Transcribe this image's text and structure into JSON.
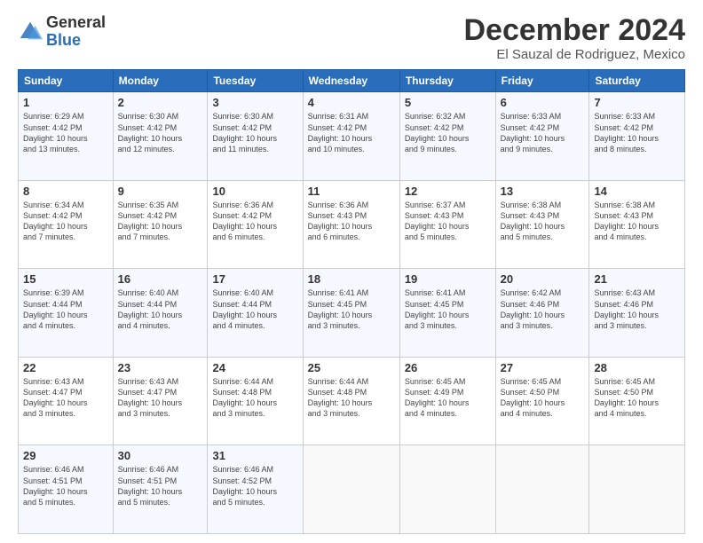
{
  "logo": {
    "general": "General",
    "blue": "Blue"
  },
  "title": "December 2024",
  "location": "El Sauzal de Rodriguez, Mexico",
  "headers": [
    "Sunday",
    "Monday",
    "Tuesday",
    "Wednesday",
    "Thursday",
    "Friday",
    "Saturday"
  ],
  "weeks": [
    [
      {
        "day": "1",
        "info": "Sunrise: 6:29 AM\nSunset: 4:42 PM\nDaylight: 10 hours\nand 13 minutes."
      },
      {
        "day": "2",
        "info": "Sunrise: 6:30 AM\nSunset: 4:42 PM\nDaylight: 10 hours\nand 12 minutes."
      },
      {
        "day": "3",
        "info": "Sunrise: 6:30 AM\nSunset: 4:42 PM\nDaylight: 10 hours\nand 11 minutes."
      },
      {
        "day": "4",
        "info": "Sunrise: 6:31 AM\nSunset: 4:42 PM\nDaylight: 10 hours\nand 10 minutes."
      },
      {
        "day": "5",
        "info": "Sunrise: 6:32 AM\nSunset: 4:42 PM\nDaylight: 10 hours\nand 9 minutes."
      },
      {
        "day": "6",
        "info": "Sunrise: 6:33 AM\nSunset: 4:42 PM\nDaylight: 10 hours\nand 9 minutes."
      },
      {
        "day": "7",
        "info": "Sunrise: 6:33 AM\nSunset: 4:42 PM\nDaylight: 10 hours\nand 8 minutes."
      }
    ],
    [
      {
        "day": "8",
        "info": "Sunrise: 6:34 AM\nSunset: 4:42 PM\nDaylight: 10 hours\nand 7 minutes."
      },
      {
        "day": "9",
        "info": "Sunrise: 6:35 AM\nSunset: 4:42 PM\nDaylight: 10 hours\nand 7 minutes."
      },
      {
        "day": "10",
        "info": "Sunrise: 6:36 AM\nSunset: 4:42 PM\nDaylight: 10 hours\nand 6 minutes."
      },
      {
        "day": "11",
        "info": "Sunrise: 6:36 AM\nSunset: 4:43 PM\nDaylight: 10 hours\nand 6 minutes."
      },
      {
        "day": "12",
        "info": "Sunrise: 6:37 AM\nSunset: 4:43 PM\nDaylight: 10 hours\nand 5 minutes."
      },
      {
        "day": "13",
        "info": "Sunrise: 6:38 AM\nSunset: 4:43 PM\nDaylight: 10 hours\nand 5 minutes."
      },
      {
        "day": "14",
        "info": "Sunrise: 6:38 AM\nSunset: 4:43 PM\nDaylight: 10 hours\nand 4 minutes."
      }
    ],
    [
      {
        "day": "15",
        "info": "Sunrise: 6:39 AM\nSunset: 4:44 PM\nDaylight: 10 hours\nand 4 minutes."
      },
      {
        "day": "16",
        "info": "Sunrise: 6:40 AM\nSunset: 4:44 PM\nDaylight: 10 hours\nand 4 minutes."
      },
      {
        "day": "17",
        "info": "Sunrise: 6:40 AM\nSunset: 4:44 PM\nDaylight: 10 hours\nand 4 minutes."
      },
      {
        "day": "18",
        "info": "Sunrise: 6:41 AM\nSunset: 4:45 PM\nDaylight: 10 hours\nand 3 minutes."
      },
      {
        "day": "19",
        "info": "Sunrise: 6:41 AM\nSunset: 4:45 PM\nDaylight: 10 hours\nand 3 minutes."
      },
      {
        "day": "20",
        "info": "Sunrise: 6:42 AM\nSunset: 4:46 PM\nDaylight: 10 hours\nand 3 minutes."
      },
      {
        "day": "21",
        "info": "Sunrise: 6:43 AM\nSunset: 4:46 PM\nDaylight: 10 hours\nand 3 minutes."
      }
    ],
    [
      {
        "day": "22",
        "info": "Sunrise: 6:43 AM\nSunset: 4:47 PM\nDaylight: 10 hours\nand 3 minutes."
      },
      {
        "day": "23",
        "info": "Sunrise: 6:43 AM\nSunset: 4:47 PM\nDaylight: 10 hours\nand 3 minutes."
      },
      {
        "day": "24",
        "info": "Sunrise: 6:44 AM\nSunset: 4:48 PM\nDaylight: 10 hours\nand 3 minutes."
      },
      {
        "day": "25",
        "info": "Sunrise: 6:44 AM\nSunset: 4:48 PM\nDaylight: 10 hours\nand 3 minutes."
      },
      {
        "day": "26",
        "info": "Sunrise: 6:45 AM\nSunset: 4:49 PM\nDaylight: 10 hours\nand 4 minutes."
      },
      {
        "day": "27",
        "info": "Sunrise: 6:45 AM\nSunset: 4:50 PM\nDaylight: 10 hours\nand 4 minutes."
      },
      {
        "day": "28",
        "info": "Sunrise: 6:45 AM\nSunset: 4:50 PM\nDaylight: 10 hours\nand 4 minutes."
      }
    ],
    [
      {
        "day": "29",
        "info": "Sunrise: 6:46 AM\nSunset: 4:51 PM\nDaylight: 10 hours\nand 5 minutes."
      },
      {
        "day": "30",
        "info": "Sunrise: 6:46 AM\nSunset: 4:51 PM\nDaylight: 10 hours\nand 5 minutes."
      },
      {
        "day": "31",
        "info": "Sunrise: 6:46 AM\nSunset: 4:52 PM\nDaylight: 10 hours\nand 5 minutes."
      },
      {
        "day": "",
        "info": ""
      },
      {
        "day": "",
        "info": ""
      },
      {
        "day": "",
        "info": ""
      },
      {
        "day": "",
        "info": ""
      }
    ]
  ]
}
